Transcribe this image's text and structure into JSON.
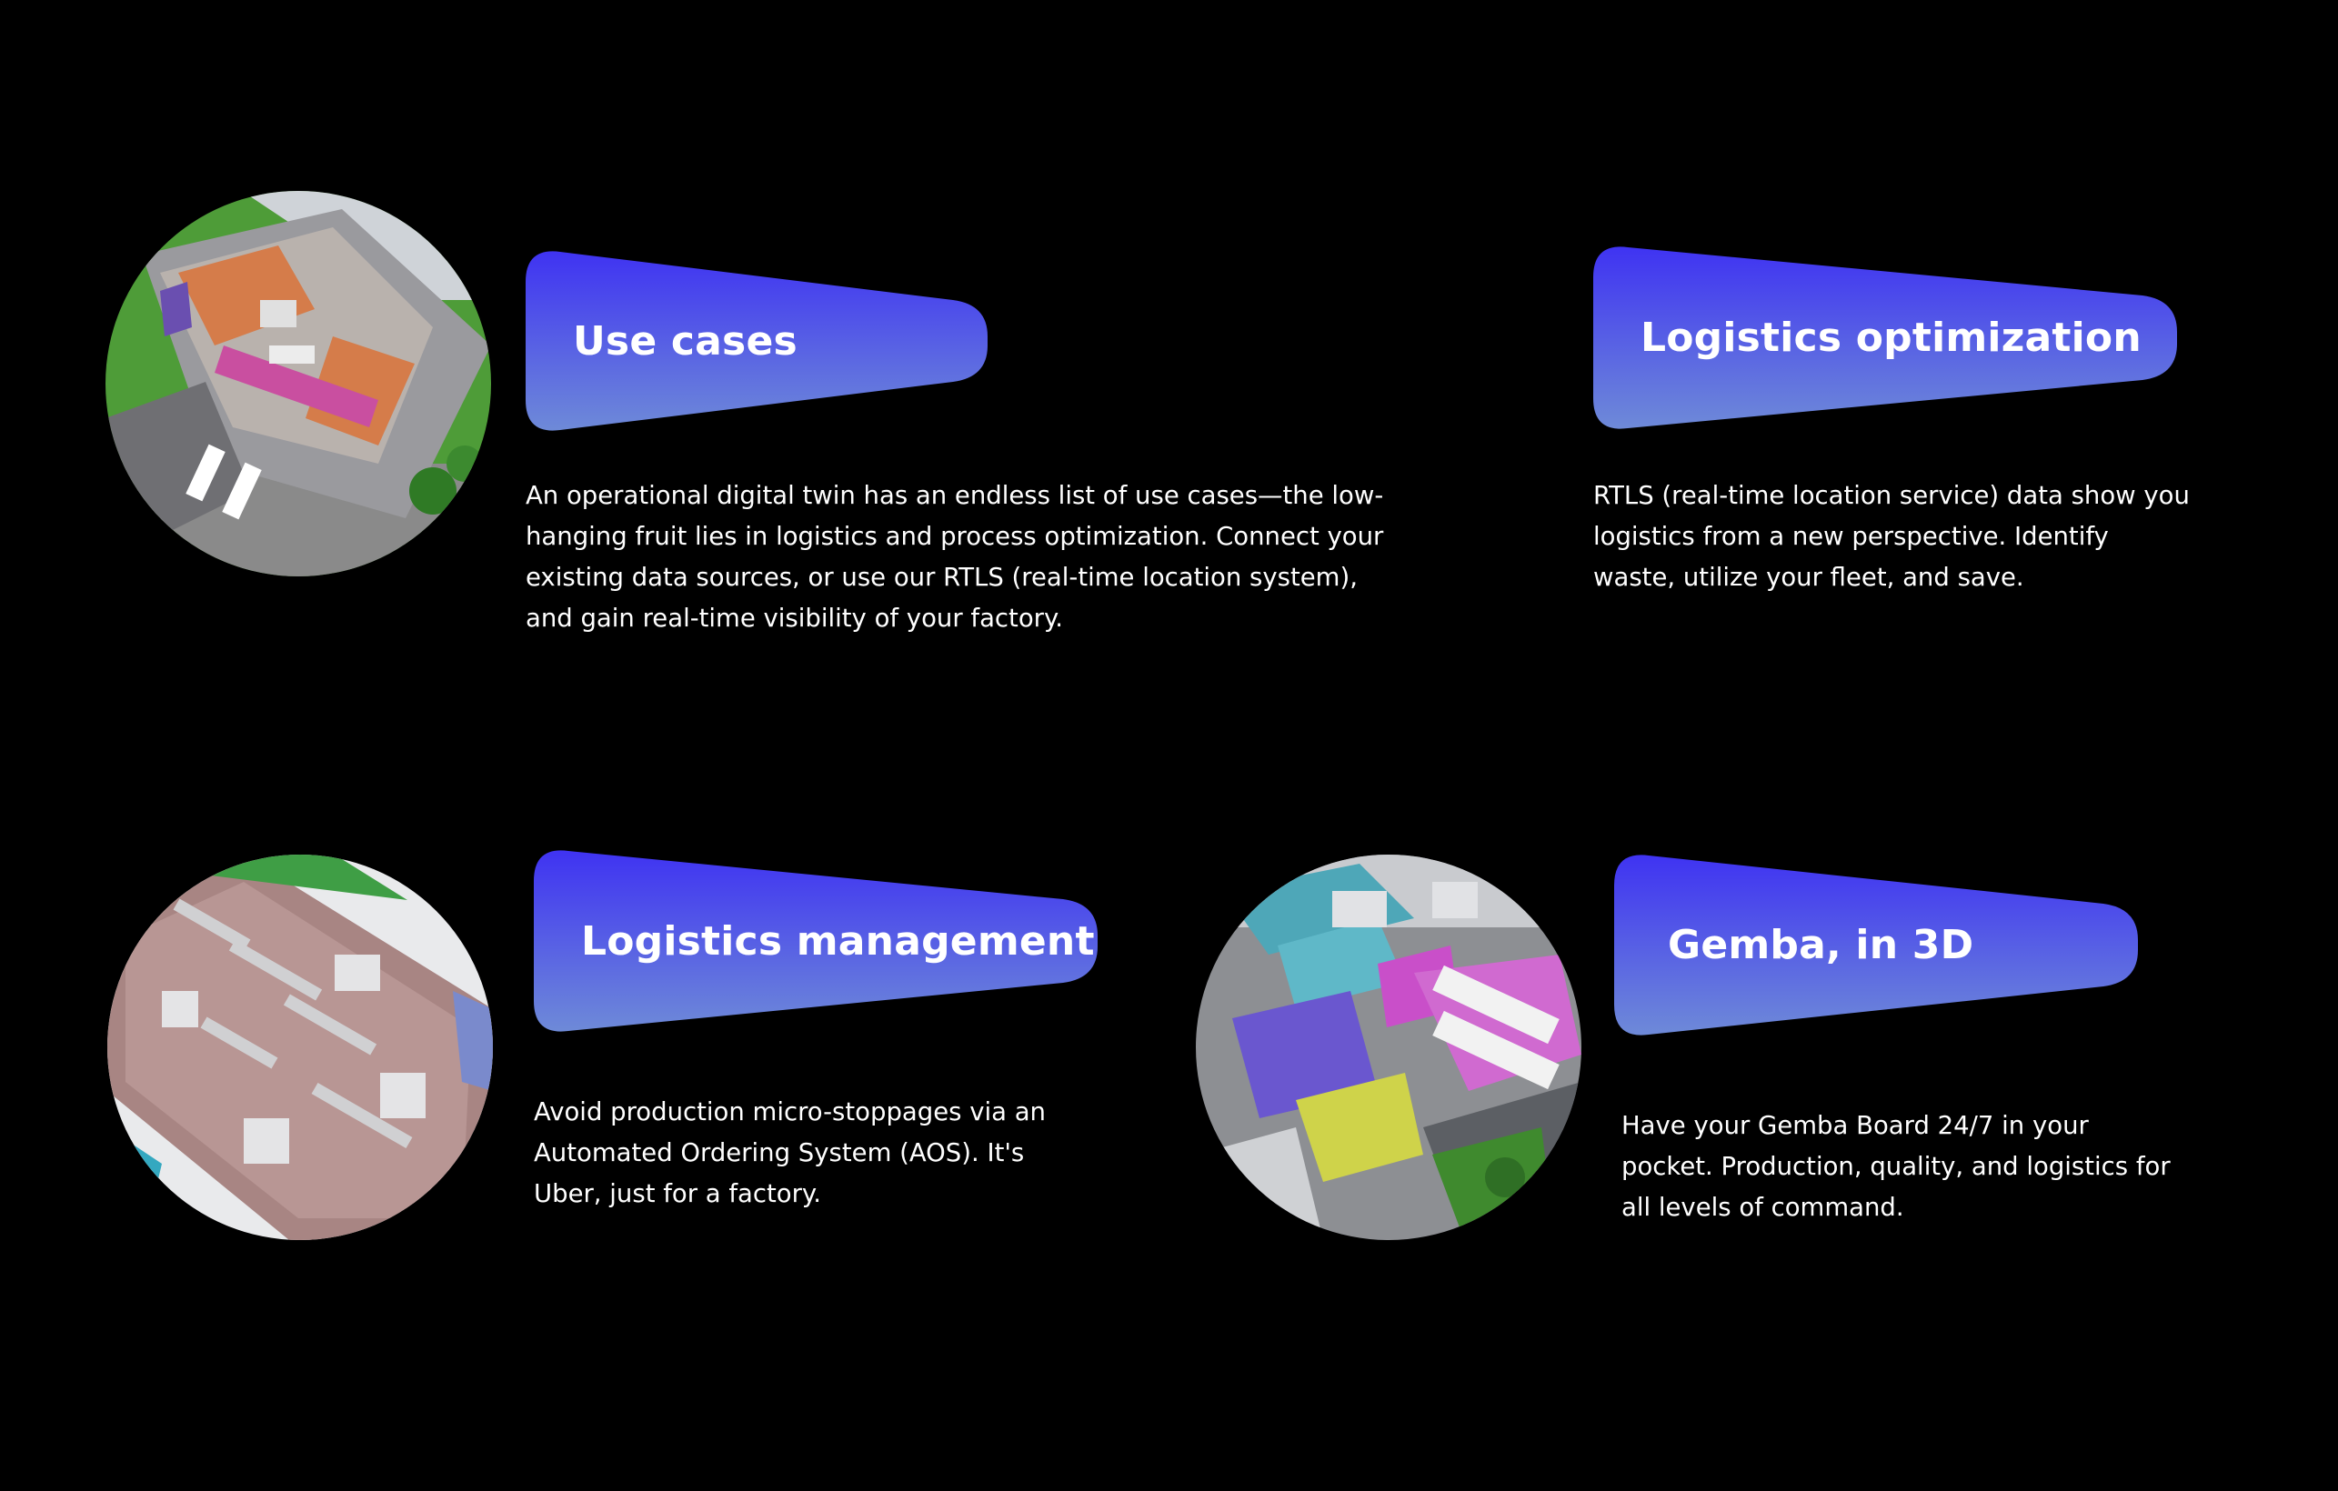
{
  "colors": {
    "background": "#000000",
    "banner_top": "#3f33f2",
    "banner_bottom": "#6e8ad8",
    "text": "#ffffff"
  },
  "cards": [
    {
      "title": "Use cases",
      "description": "An operational digital twin has an endless list of use cases—the low-hanging fruit lies in logistics and process optimization. Connect your existing data sources, or use our RTLS (real-time location system), and gain real-time visibility of your factory."
    },
    {
      "title": "Logistics optimization",
      "description": "RTLS (real-time location service) data show you logistics from a new perspective. Identify waste, utilize your fleet, and save."
    },
    {
      "title": "Logistics management",
      "description": "Avoid production micro-stoppages via an Automated Ordering System (AOS). It's Uber, just for a factory."
    },
    {
      "title": "Gemba, in 3D",
      "description": "Have your Gemba Board 24/7 in your pocket. Production, quality, and logistics for all levels of command."
    }
  ]
}
